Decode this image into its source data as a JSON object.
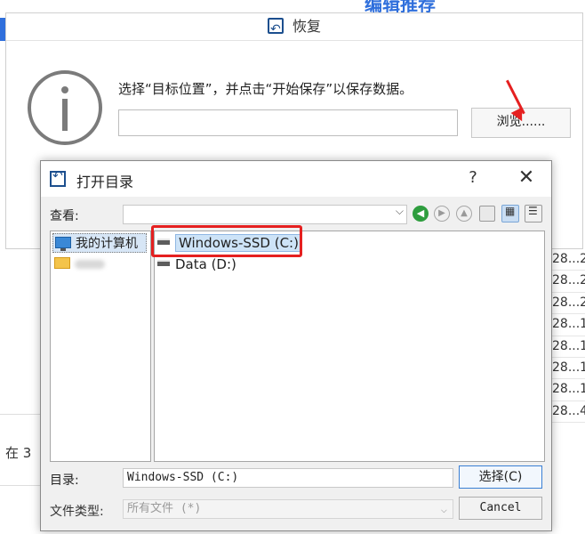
{
  "background": {
    "header_text": "编辑推荐",
    "bottom_text": "在 3",
    "list_values": [
      "28...2",
      "28...2",
      "28...2",
      "28...1",
      "28...1",
      "28...1",
      "28...1",
      "28...4"
    ]
  },
  "restore_dialog": {
    "title": "恢复",
    "message": "选择“目标位置”，并点击“开始保存”以保存数据。",
    "path_value": "",
    "browse_label": "浏览......"
  },
  "open_dialog": {
    "title": "打开目录",
    "help_label": "?",
    "close_label": "✕",
    "lookin_label": "查看:",
    "lookin_value": "",
    "sidebar": [
      {
        "label": "我的计算机",
        "icon": "computer-icon"
      },
      {
        "label": "",
        "icon": "folder-icon"
      }
    ],
    "files": [
      {
        "label": "Windows-SSD (C:)",
        "icon": "drive-icon"
      },
      {
        "label": "Data (D:)",
        "icon": "drive-icon"
      }
    ],
    "directory_label": "目录:",
    "directory_value": "Windows-SSD (C:)",
    "filetype_label": "文件类型:",
    "filetype_value": "所有文件 (*)",
    "ok_label": "选择(C)",
    "cancel_label": "Cancel"
  },
  "colors": {
    "highlight": "#e52020",
    "accent": "#2f6fdc",
    "selection": "#cde3f7"
  }
}
